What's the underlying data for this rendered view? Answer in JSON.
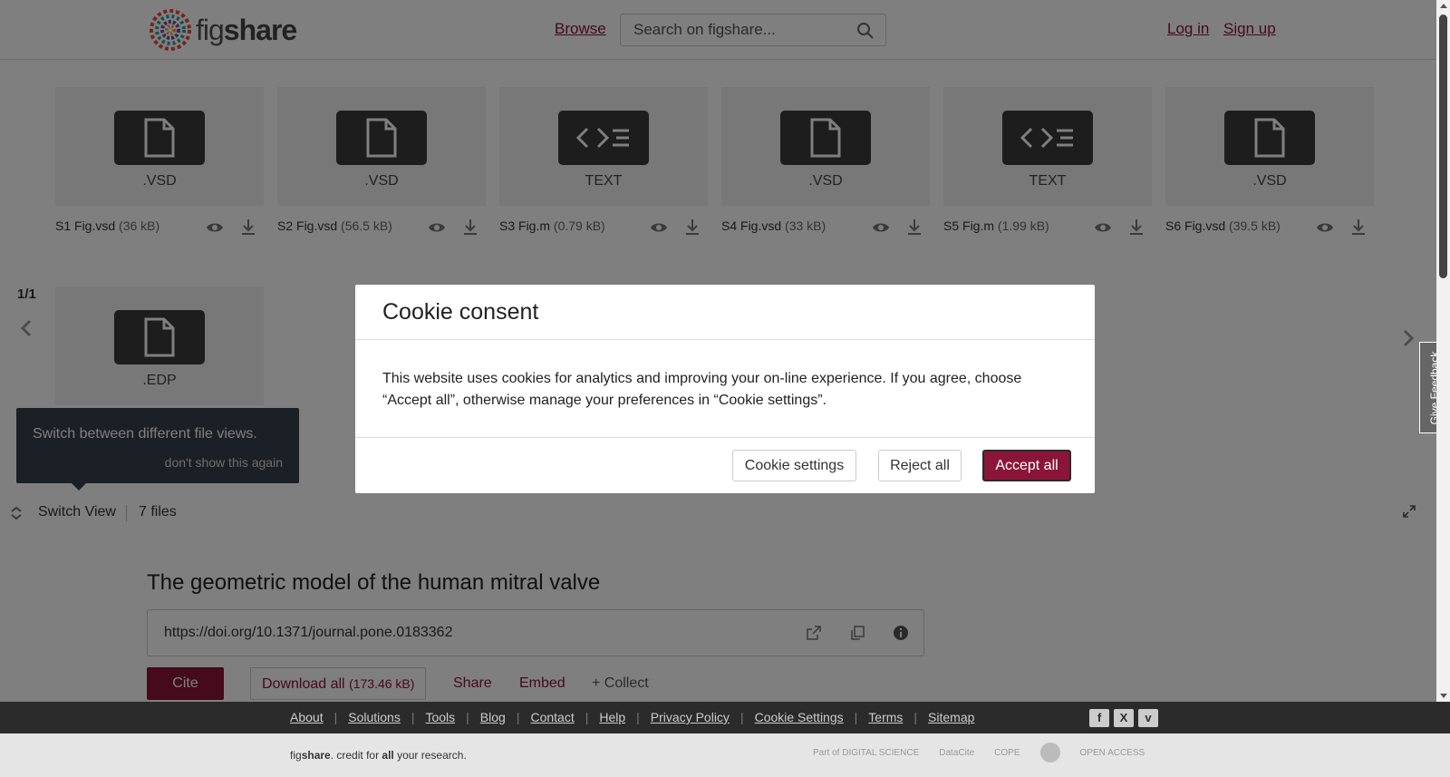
{
  "header": {
    "logo_text_a": "fig",
    "logo_text_b": "share",
    "browse": "Browse",
    "search_placeholder": "Search on figshare...",
    "login": "Log in",
    "signup": "Sign up"
  },
  "files": [
    {
      "name": "S1 Fig.vsd",
      "size": "(36 kB)",
      "ext": ".VSD",
      "icon": "document-icon"
    },
    {
      "name": "S2 Fig.vsd",
      "size": "(56.5 kB)",
      "ext": ".VSD",
      "icon": "document-icon"
    },
    {
      "name": "S3 Fig.m",
      "size": "(0.79 kB)",
      "ext": "TEXT",
      "icon": "code-icon"
    },
    {
      "name": "S4 Fig.vsd",
      "size": "(33 kB)",
      "ext": ".VSD",
      "icon": "document-icon"
    },
    {
      "name": "S5 Fig.m",
      "size": "(1.99 kB)",
      "ext": "TEXT",
      "icon": "code-icon"
    },
    {
      "name": "S6 Fig.vsd",
      "size": "(39.5 kB)",
      "ext": ".VSD",
      "icon": "document-icon"
    },
    {
      "name": "",
      "size": "",
      "ext": ".EDP",
      "icon": "document-icon"
    }
  ],
  "viewer": {
    "page_indicator": "1/1",
    "tip_message": "Switch between different file views.",
    "tip_dismiss": "don't show this again",
    "switch_view": "Switch View",
    "file_count": "7 files"
  },
  "item": {
    "title": "The geometric model of the human mitral valve",
    "doi": "https://doi.org/10.1371/journal.pone.0183362",
    "cite": "Cite",
    "download_all": "Download all",
    "download_size": "(173.46 kB)",
    "share": "Share",
    "embed": "Embed",
    "collect": "+ Collect"
  },
  "cookie": {
    "title": "Cookie consent",
    "body": "This website uses cookies for analytics and improving your on-line experience. If you agree, choose “Accept all”, otherwise manage your preferences in “Cookie settings”.",
    "settings": "Cookie settings",
    "reject": "Reject all",
    "accept": "Accept all"
  },
  "feedback": "Give Feedback",
  "footer": {
    "links": [
      "About",
      "Solutions",
      "Tools",
      "Blog",
      "Contact",
      "Help",
      "Privacy Policy",
      "Cookie Settings",
      "Terms",
      "Sitemap"
    ],
    "tagline_a": "fig",
    "tagline_b": "share",
    "tagline_c": ". credit for ",
    "tagline_d": "all",
    "tagline_e": " your research.",
    "partners": [
      "Part of DIGITAL SCIENCE",
      "DataCite",
      "COPE",
      "",
      "OPEN ACCESS"
    ]
  },
  "colors": {
    "brand": "#8a1538",
    "overlay": "rgba(0,0,0,0.5)",
    "tip_bg": "#36414d"
  }
}
